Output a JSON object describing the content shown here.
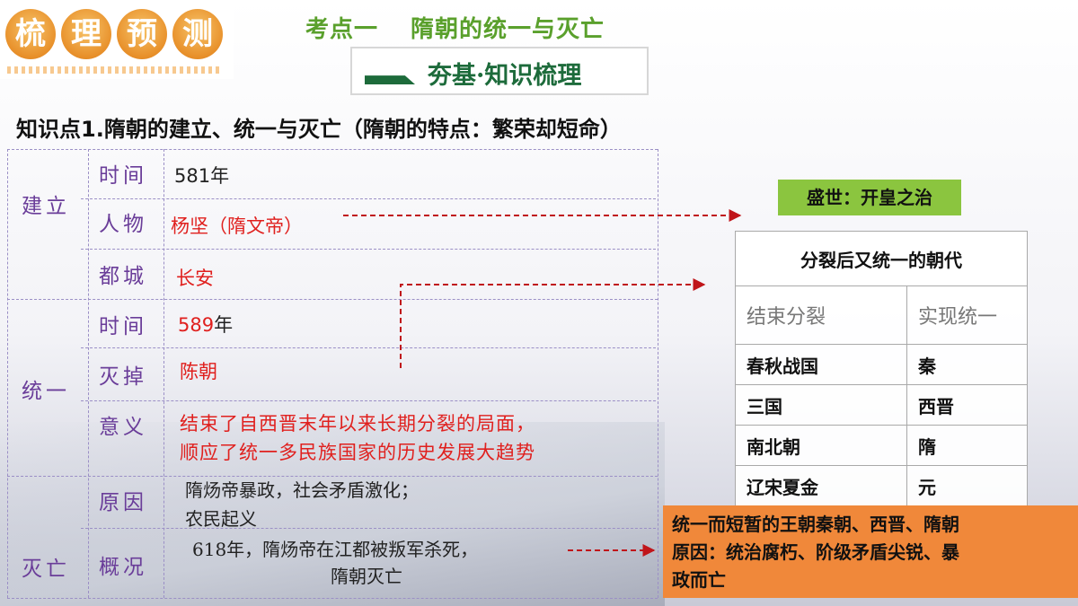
{
  "badge": {
    "chars": [
      "梳",
      "理",
      "预",
      "测"
    ]
  },
  "topic": {
    "part1": "考点一",
    "part2": "隋朝的统一与灭亡"
  },
  "banner": {
    "text": "夯基·知识梳理"
  },
  "heading": "知识点1.隋朝的建立、统一与灭亡（隋朝的特点：繁荣却短命）",
  "groups": {
    "establish": "建立",
    "unify": "统一",
    "fall": "灭亡"
  },
  "rows": {
    "time1": {
      "label": "时间",
      "value": "581年"
    },
    "person": {
      "label": "人物",
      "value": "杨坚（隋文帝）"
    },
    "capital": {
      "label": "都城",
      "value": "长安"
    },
    "time2": {
      "label": "时间",
      "value_num": "589",
      "value_suffix": "年"
    },
    "destroy": {
      "label": "灭掉",
      "value": "陈朝"
    },
    "meaning": {
      "label": "意义",
      "line1": "结束了自西晋末年以来长期分裂的局面，",
      "line2": "顺应了统一多民族国家的历史发展大趋势"
    },
    "reason": {
      "label": "原因",
      "line1": "隋炀帝暴政，社会矛盾激化；",
      "line2": "农民起义"
    },
    "overview": {
      "label": "概况",
      "line1": "618年，隋炀帝在江都被叛军杀死，",
      "line2": "隋朝灭亡"
    }
  },
  "prosperity": "盛世：开皇之治",
  "dynasty_table": {
    "title": "分裂后又统一的朝代",
    "headers": [
      "结束分裂",
      "实现统一"
    ],
    "rows": [
      [
        "春秋战国",
        "秦"
      ],
      [
        "三国",
        "西晋"
      ],
      [
        "南北朝",
        "隋"
      ],
      [
        "辽宋夏金",
        "元"
      ]
    ]
  },
  "note": {
    "line1": "统一而短暂的王朝秦朝、西晋、隋朝",
    "line2": "原因：统治腐朽、阶级矛盾尖锐、暴",
    "line3": "政而亡"
  },
  "colors": {
    "label_purple": "#6a3d99",
    "value_red": "#e0201e",
    "topic_green": "#5aa02c",
    "banner_green": "#1d6b3b",
    "prosperity_box": "#8bc53f",
    "note_box": "#f0883a",
    "badge_orange": "#e8902a"
  }
}
